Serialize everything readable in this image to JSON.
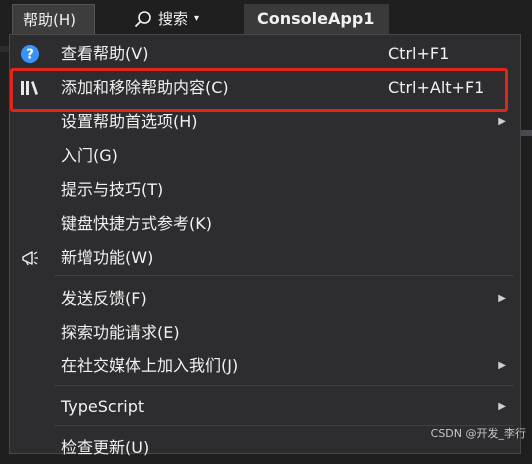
{
  "menubar": {
    "help_menu": "帮助(H)",
    "search_label": "搜索",
    "search_caret": "▾",
    "project_name": "ConsoleApp1"
  },
  "menu": {
    "items": [
      {
        "label": "查看帮助(V)",
        "shortcut": "Ctrl+F1",
        "icon": "help-circle-icon"
      },
      {
        "label": "添加和移除帮助内容(C)",
        "shortcut": "Ctrl+Alt+F1",
        "icon": "library-books-icon"
      },
      {
        "label": "设置帮助首选项(H)",
        "submenu": true
      },
      {
        "label": "入门(G)"
      },
      {
        "label": "提示与技巧(T)"
      },
      {
        "label": "键盘快捷方式参考(K)"
      },
      {
        "label": "新增功能(W)",
        "icon": "megaphone-icon"
      },
      {
        "label": "发送反馈(F)",
        "submenu": true
      },
      {
        "label": "探索功能请求(E)"
      },
      {
        "label": "在社交媒体上加入我们(J)",
        "submenu": true
      },
      {
        "label": "TypeScript",
        "submenu": true
      },
      {
        "label": "检查更新(U)"
      }
    ],
    "submenu_arrow": "▶"
  },
  "watermark": "CSDN @开发_李行",
  "colors": {
    "background": "#1f1f1f",
    "menu_background": "#2d2d30",
    "highlight_border": "#e1251b",
    "help_icon": "#3794ff"
  }
}
